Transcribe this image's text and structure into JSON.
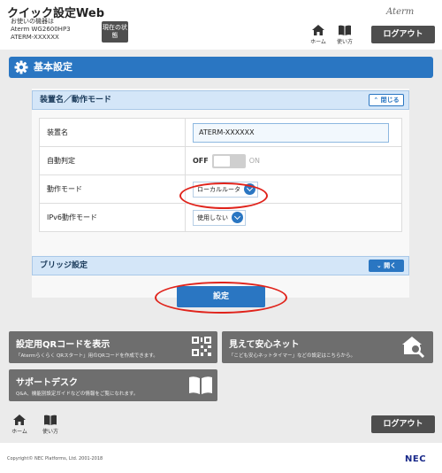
{
  "header": {
    "app_title": "クイック設定Web",
    "device_label": "お使いの機器は",
    "device_model": "Aterm WG2600HP3",
    "device_name": "ATERM-XXXXXX",
    "status_button": "現在の状態",
    "brand_logo": "Aterm",
    "home_label": "ホーム",
    "help_label": "使い方",
    "logout_label": "ログアウト"
  },
  "section": {
    "title": "基本設定"
  },
  "panel": {
    "title": "装置名／動作モード",
    "collapse_button": "閉じる",
    "rows": {
      "device_name_label": "装置名",
      "device_name_value": "ATERM-XXXXXX",
      "auto_detect_label": "自動判定",
      "auto_detect_off": "OFF",
      "auto_detect_on": "ON",
      "operation_mode_label": "動作モード",
      "operation_mode_value": "ローカルルータ",
      "ipv6_mode_label": "IPv6動作モード",
      "ipv6_mode_value": "使用しない"
    }
  },
  "bridge": {
    "title": "ブリッジ設定",
    "open_button": "開く"
  },
  "submit_label": "設定",
  "cards": {
    "qr": {
      "title": "設定用QRコードを表示",
      "desc": "「Atermらくらく QRスタート」用のQRコードを作成できます。"
    },
    "safe": {
      "title": "見えて安心ネット",
      "desc": "「こども安心ネットタイマー」などの設定はこちらから。"
    },
    "support": {
      "title": "サポートデスク",
      "desc": "Q&A、機能別設定ガイドなどの情報をご覧になれます。"
    }
  },
  "footer": {
    "home_label": "ホーム",
    "help_label": "使い方",
    "logout_label": "ログアウト",
    "copyright": "Copyright© NEC Platforms, Ltd. 2001-2018",
    "nec_logo": "NEC"
  },
  "colors": {
    "accent": "#2a76c2",
    "highlight": "#e0231b",
    "dark_button": "#4e4e4e",
    "card": "#6e6e6e"
  }
}
